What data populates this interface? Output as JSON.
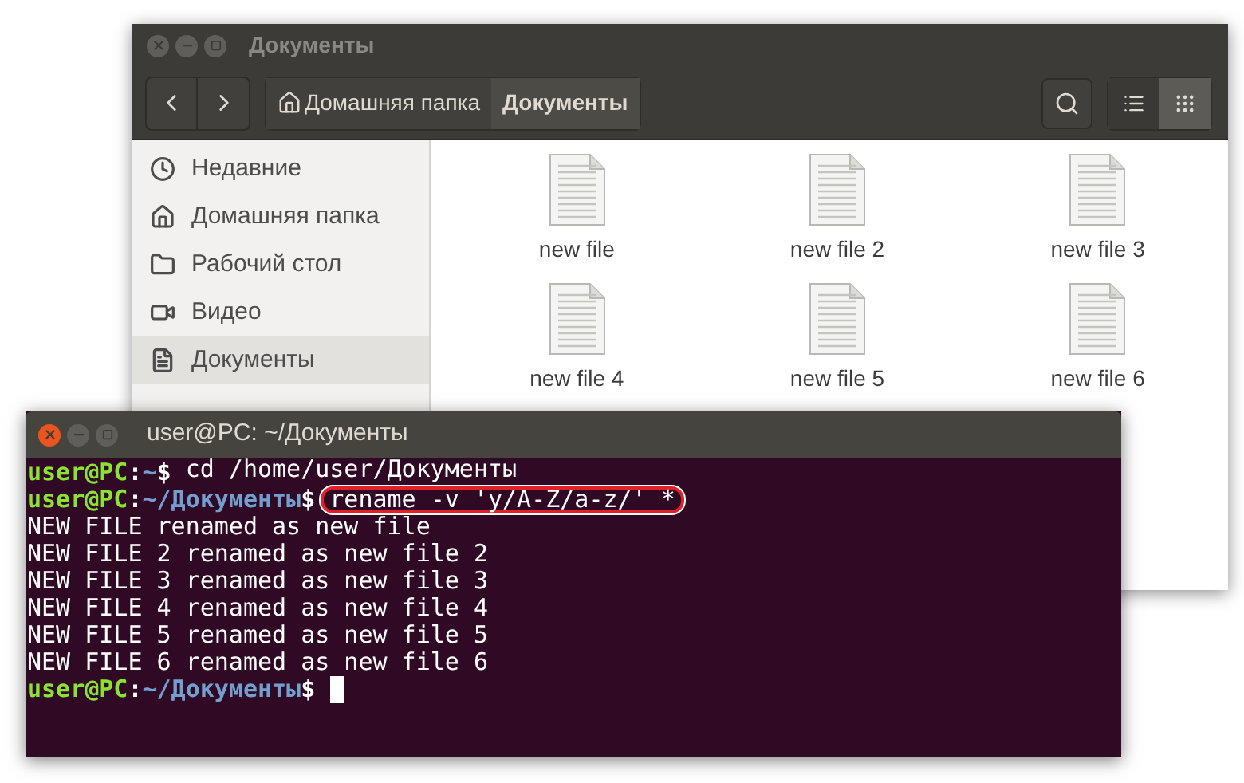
{
  "file_manager": {
    "title": "Документы",
    "breadcrumbs": [
      {
        "label": "Домашняя папка",
        "kind": "home",
        "selected": false
      },
      {
        "label": "Документы",
        "kind": "plain",
        "selected": true
      }
    ],
    "view_modes": [
      {
        "kind": "list",
        "selected": false
      },
      {
        "kind": "grid",
        "selected": true
      }
    ],
    "sidebar": {
      "items": [
        {
          "label": "Недавние",
          "kind": "recent",
          "selected": false
        },
        {
          "label": "Домашняя папка",
          "kind": "home",
          "selected": false
        },
        {
          "label": "Рабочий стол",
          "kind": "desktop",
          "selected": false
        },
        {
          "label": "Видео",
          "kind": "video",
          "selected": false
        },
        {
          "label": "Документы",
          "kind": "document",
          "selected": true
        }
      ]
    },
    "files": [
      {
        "name": "new file"
      },
      {
        "name": "new file 2"
      },
      {
        "name": "new file 3"
      },
      {
        "name": "new file 4"
      },
      {
        "name": "new file 5"
      },
      {
        "name": "new file 6"
      }
    ]
  },
  "terminal": {
    "title": "user@PC: ~/Документы",
    "lines": [
      {
        "kind": "prompt",
        "user": "user@PC",
        "colon": ":",
        "path": "~",
        "dollar": "$",
        "command": "cd /home/user/Документы"
      },
      {
        "kind": "prompt",
        "user": "user@PC",
        "colon": ":",
        "path": "~/Документы",
        "dollar": "$",
        "command": "rename -v 'y/A-Z/a-z/' *",
        "highlighted": true
      },
      {
        "kind": "output",
        "text": "NEW FILE renamed as new file"
      },
      {
        "kind": "output",
        "text": "NEW FILE 2 renamed as new file 2"
      },
      {
        "kind": "output",
        "text": "NEW FILE 3 renamed as new file 3"
      },
      {
        "kind": "output",
        "text": "NEW FILE 4 renamed as new file 4"
      },
      {
        "kind": "output",
        "text": "NEW FILE 5 renamed as new file 5"
      },
      {
        "kind": "output",
        "text": "NEW FILE 6 renamed as new file 6"
      },
      {
        "kind": "prompt",
        "user": "user@PC",
        "colon": ":",
        "path": "~/Документы",
        "dollar": "$",
        "cursor": true
      }
    ]
  }
}
